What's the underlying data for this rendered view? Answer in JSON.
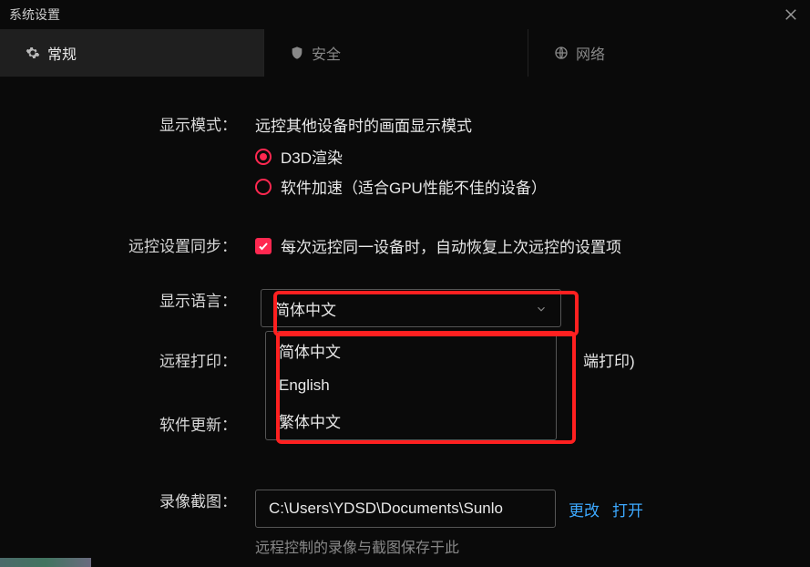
{
  "titlebar": {
    "title": "系统设置"
  },
  "tabs": [
    {
      "label": "常规",
      "active": true
    },
    {
      "label": "安全",
      "active": false
    },
    {
      "label": "网络",
      "active": false
    }
  ],
  "settings": {
    "display_mode": {
      "label": "显示模式：",
      "desc": "远控其他设备时的画面显示模式",
      "options": [
        {
          "label": "D3D渲染",
          "checked": true
        },
        {
          "label": "软件加速（适合GPU性能不佳的设备）",
          "checked": false
        }
      ]
    },
    "sync": {
      "label": "远控设置同步：",
      "checkbox_label": "每次远控同一设备时，自动恢复上次远控的设置项",
      "checked": true
    },
    "language": {
      "label": "显示语言：",
      "selected": "简体中文",
      "options": [
        "简体中文",
        "English",
        "繁体中文"
      ]
    },
    "remote_print": {
      "label": "远程打印：",
      "tail": "端打印)"
    },
    "update": {
      "label": "软件更新：",
      "selected_partial": "……"
    },
    "recording": {
      "label": "录像截图：",
      "path": "C:\\Users\\YDSD\\Documents\\Sunlo",
      "change": "更改",
      "open": "打开",
      "desc": "远程控制的录像与截图保存于此"
    }
  }
}
